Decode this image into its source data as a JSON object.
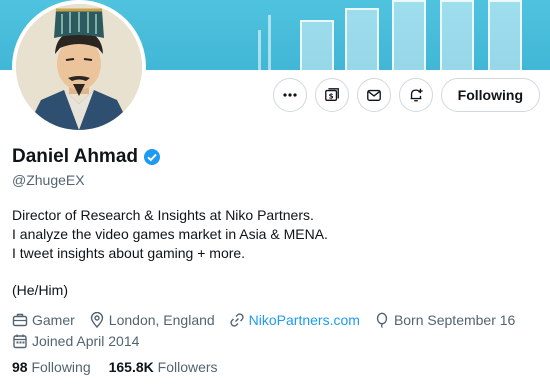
{
  "profile": {
    "name": "Daniel Ahmad",
    "handle": "@ZhugeEX",
    "verified_color": "#1d9bf0",
    "bio_lines": [
      "Director of Research & Insights at Niko Partners.",
      "I analyze the video games market in Asia & MENA.",
      "I tweet insights about gaming + more."
    ],
    "pronouns": "(He/Him)"
  },
  "actions": {
    "more_icon": "more-icon",
    "subscribe_icon": "subscribe-icon",
    "message_icon": "message-icon",
    "notify_icon": "notify-icon",
    "follow_label": "Following"
  },
  "meta": {
    "category": "Gamer",
    "location": "London, England",
    "website": "NikoPartners.com",
    "birthday": "Born September 16",
    "joined": "Joined April 2014"
  },
  "counts": {
    "following_num": "98",
    "following_label": "Following",
    "followers_num": "165.8K",
    "followers_label": "Followers"
  },
  "colors": {
    "banner": "#41b6d6",
    "link": "#1d9bf0",
    "secondary_text": "#536471"
  }
}
